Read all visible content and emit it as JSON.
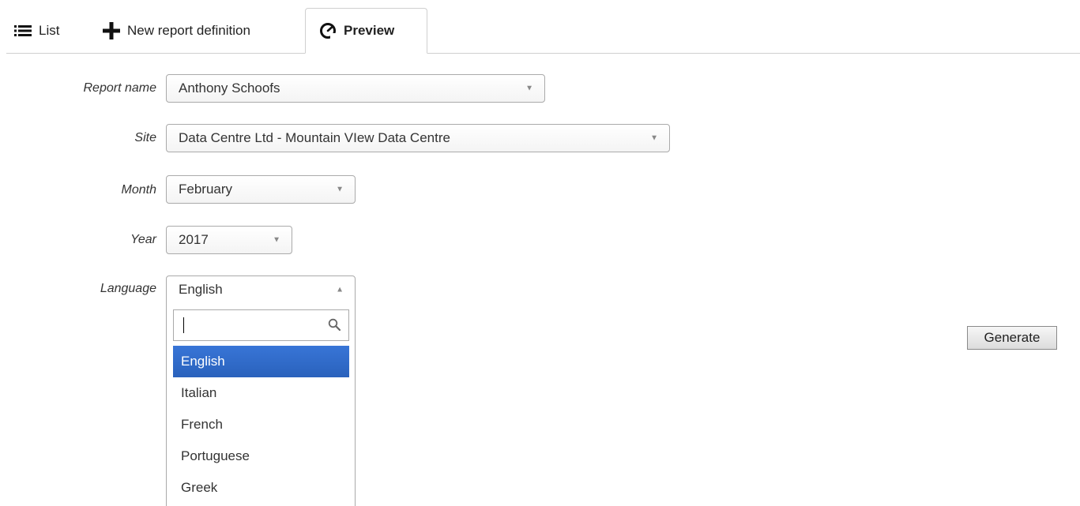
{
  "tabs": {
    "list": {
      "label": "List",
      "icon": "list-icon"
    },
    "new_report": {
      "label": "New report definition",
      "icon": "plus-icon"
    },
    "preview": {
      "label": "Preview",
      "icon": "dashboard-gauge-icon",
      "active": true
    }
  },
  "form": {
    "report_name": {
      "label": "Report name",
      "value": "Anthony Schoofs"
    },
    "site": {
      "label": "Site",
      "value": "Data Centre Ltd - Mountain VIew Data Centre"
    },
    "month": {
      "label": "Month",
      "value": "February"
    },
    "year": {
      "label": "Year",
      "value": "2017"
    },
    "language": {
      "label": "Language",
      "value": "English",
      "open": true,
      "search_value": "",
      "options": [
        "English",
        "Italian",
        "French",
        "Portuguese",
        "Greek"
      ],
      "selected_index": 0
    }
  },
  "actions": {
    "generate_label": "Generate"
  },
  "colors": {
    "selected_option_bg": "#3875d7",
    "border": "#aaaaaa"
  }
}
